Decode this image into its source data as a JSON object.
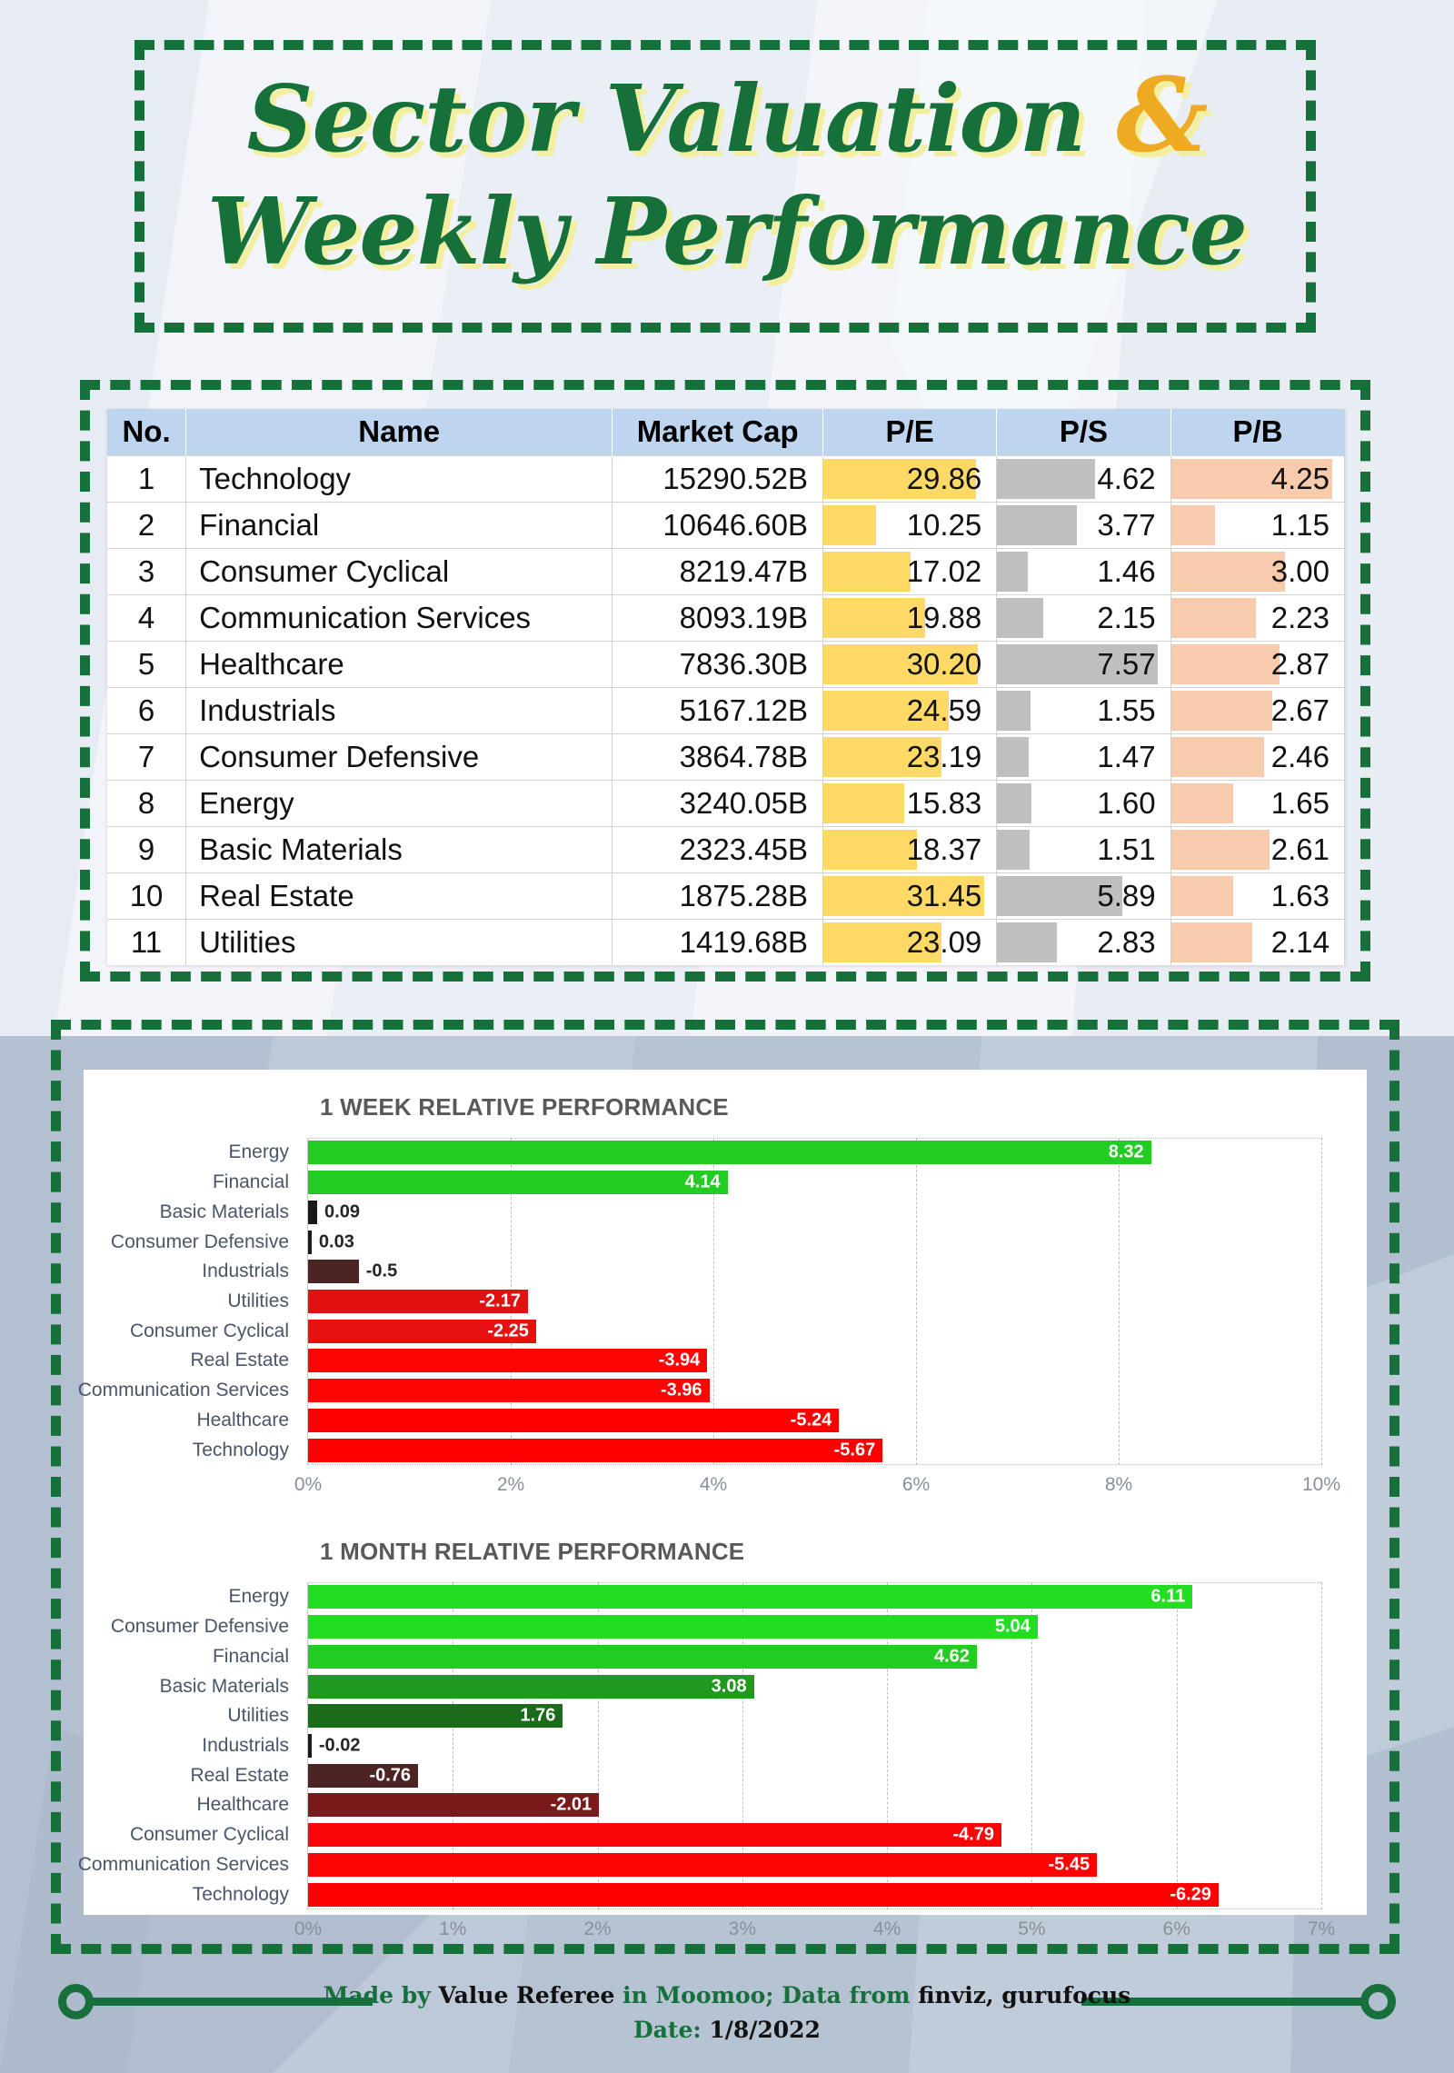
{
  "title": {
    "line1_a": "Sector Valuation ",
    "amp": "&",
    "line2": "Weekly Performance"
  },
  "colors": {
    "green_dark": "#16703a",
    "amber": "#eeaa22",
    "title_shadow": "#f2f0a0",
    "header_blue": "#bdd5ee",
    "pe_bar": "#ffd966",
    "ps_bar": "#bfbfbf",
    "pb_bar": "#f8cbad",
    "bright_green": "#22cc22",
    "bright_red": "#ff0000",
    "dark_green": "#1e6b1e",
    "dark_red": "#4d1616"
  },
  "table": {
    "headers": [
      "No.",
      "Name",
      "Market Cap",
      "P/E",
      "P/S",
      "P/B"
    ],
    "rows": [
      {
        "no": "1",
        "name": "Technology",
        "mcap": "15290.52B",
        "pe": "29.86",
        "ps": "4.62",
        "pb": "4.25"
      },
      {
        "no": "2",
        "name": "Financial",
        "mcap": "10646.60B",
        "pe": "10.25",
        "ps": "3.77",
        "pb": "1.15"
      },
      {
        "no": "3",
        "name": "Consumer Cyclical",
        "mcap": "8219.47B",
        "pe": "17.02",
        "ps": "1.46",
        "pb": "3.00"
      },
      {
        "no": "4",
        "name": "Communication Services",
        "mcap": "8093.19B",
        "pe": "19.88",
        "ps": "2.15",
        "pb": "2.23"
      },
      {
        "no": "5",
        "name": "Healthcare",
        "mcap": "7836.30B",
        "pe": "30.20",
        "ps": "7.57",
        "pb": "2.87"
      },
      {
        "no": "6",
        "name": "Industrials",
        "mcap": "5167.12B",
        "pe": "24.59",
        "ps": "1.55",
        "pb": "2.67"
      },
      {
        "no": "7",
        "name": "Consumer Defensive",
        "mcap": "3864.78B",
        "pe": "23.19",
        "ps": "1.47",
        "pb": "2.46"
      },
      {
        "no": "8",
        "name": "Energy",
        "mcap": "3240.05B",
        "pe": "15.83",
        "ps": "1.60",
        "pb": "1.65"
      },
      {
        "no": "9",
        "name": "Basic Materials",
        "mcap": "2323.45B",
        "pe": "18.37",
        "ps": "1.51",
        "pb": "2.61"
      },
      {
        "no": "10",
        "name": "Real Estate",
        "mcap": "1875.28B",
        "pe": "31.45",
        "ps": "5.89",
        "pb": "1.63"
      },
      {
        "no": "11",
        "name": "Utilities",
        "mcap": "1419.68B",
        "pe": "23.09",
        "ps": "2.83",
        "pb": "2.14"
      }
    ]
  },
  "chart_data": [
    {
      "type": "bar",
      "title": "1 WEEK RELATIVE PERFORMANCE",
      "orientation": "horizontal",
      "xlabel": "",
      "ylabel": "",
      "xlim": [
        0,
        10
      ],
      "xticks": [
        "0%",
        "2%",
        "4%",
        "6%",
        "8%",
        "10%"
      ],
      "grid": true,
      "categories": [
        "Energy",
        "Financial",
        "Basic Materials",
        "Consumer Defensive",
        "Industrials",
        "Utilities",
        "Consumer Cyclical",
        "Real Estate",
        "Communication Services",
        "Healthcare",
        "Technology"
      ],
      "values": [
        8.32,
        4.14,
        0.09,
        0.03,
        -0.5,
        -2.17,
        -2.25,
        -3.94,
        -3.96,
        -5.24,
        -5.67
      ],
      "labels": [
        "8.32",
        "4.14",
        "0.09",
        "0.03",
        "-0.5",
        "-2.17",
        "-2.25",
        "-3.94",
        "-3.96",
        "-5.24",
        "-5.67"
      ],
      "bar_colors": [
        "#22cc22",
        "#22cc22",
        "#1a1a1a",
        "#1a1a1a",
        "#4d2424",
        "#e01111",
        "#e81111",
        "#fb0505",
        "#fb0505",
        "#ff0000",
        "#ff0000"
      ]
    },
    {
      "type": "bar",
      "title": "1 MONTH RELATIVE PERFORMANCE",
      "orientation": "horizontal",
      "xlabel": "",
      "ylabel": "",
      "xlim": [
        0,
        7
      ],
      "xticks": [
        "0%",
        "1%",
        "2%",
        "3%",
        "4%",
        "5%",
        "6%",
        "7%"
      ],
      "grid": true,
      "categories": [
        "Energy",
        "Consumer Defensive",
        "Financial",
        "Basic Materials",
        "Utilities",
        "Industrials",
        "Real Estate",
        "Healthcare",
        "Consumer Cyclical",
        "Communication Services",
        "Technology"
      ],
      "values": [
        6.11,
        5.04,
        4.62,
        3.08,
        1.76,
        -0.02,
        -0.76,
        -2.01,
        -4.79,
        -5.45,
        -6.29
      ],
      "labels": [
        "6.11",
        "5.04",
        "4.62",
        "3.08",
        "1.76",
        "-0.02",
        "-0.76",
        "-2.01",
        "-4.79",
        "-5.45",
        "-6.29"
      ],
      "bar_colors": [
        "#22dd22",
        "#22dd22",
        "#22cc22",
        "#1f9a1f",
        "#1a6b1a",
        "#1a1a1a",
        "#4d2424",
        "#7a1a1a",
        "#f90606",
        "#fb0404",
        "#ff0000"
      ]
    }
  ],
  "footer": {
    "made_by_a": "Made by ",
    "made_by_b": "Value Referee",
    "made_by_c": " in Moomoo; Data from ",
    "made_by_d": "finviz, gurufocus",
    "date": "Date: 1/8/2022"
  }
}
